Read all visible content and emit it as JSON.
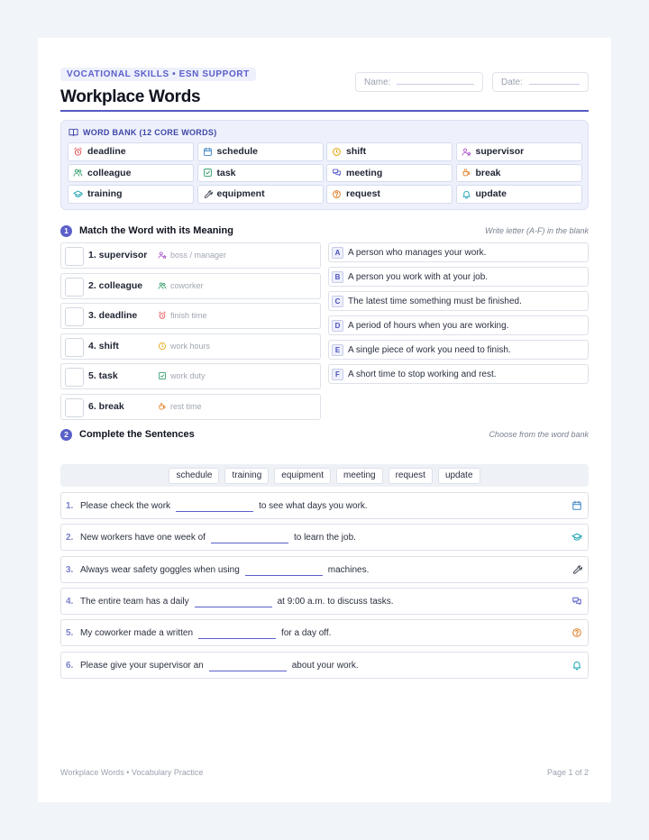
{
  "header": {
    "eyebrow": "VOCATIONAL SKILLS • ESN SUPPORT",
    "title": "Workplace Words",
    "name_label": "Name:",
    "date_label": "Date:"
  },
  "word_bank": {
    "title": "WORD BANK (12 CORE WORDS)",
    "words": [
      {
        "label": "deadline",
        "icon": "alarm-clock-icon",
        "color": "#e5484d"
      },
      {
        "label": "schedule",
        "icon": "calendar-icon",
        "color": "#3b82c4"
      },
      {
        "label": "shift",
        "icon": "clock-icon",
        "color": "#e0a100"
      },
      {
        "label": "supervisor",
        "icon": "user-star-icon",
        "color": "#a855c7"
      },
      {
        "label": "colleague",
        "icon": "users-icon",
        "color": "#2f9e6a"
      },
      {
        "label": "task",
        "icon": "check-square-icon",
        "color": "#2f9e6a"
      },
      {
        "label": "meeting",
        "icon": "chat-bubbles-icon",
        "color": "#5a5fc9"
      },
      {
        "label": "break",
        "icon": "coffee-cup-icon",
        "color": "#e07a1f"
      },
      {
        "label": "training",
        "icon": "graduation-cap-icon",
        "color": "#1aa3b3"
      },
      {
        "label": "equipment",
        "icon": "wrench-icon",
        "color": "#444a57"
      },
      {
        "label": "request",
        "icon": "question-circle-icon",
        "color": "#e07a1f"
      },
      {
        "label": "update",
        "icon": "bell-icon",
        "color": "#1aa3b3"
      }
    ]
  },
  "section1": {
    "number": "1",
    "title": "Match the Word with its Meaning",
    "hint": "Write letter (A-F) in the blank",
    "words": [
      {
        "label": "1. supervisor",
        "hint": "boss / manager",
        "icon": "user-star-icon",
        "color": "#a855c7"
      },
      {
        "label": "2. colleague",
        "hint": "coworker",
        "icon": "users-icon",
        "color": "#2f9e6a"
      },
      {
        "label": "3. deadline",
        "hint": "finish time",
        "icon": "alarm-clock-icon",
        "color": "#e5484d"
      },
      {
        "label": "4. shift",
        "hint": "work hours",
        "icon": "clock-icon",
        "color": "#e0a100"
      },
      {
        "label": "5. task",
        "hint": "work duty",
        "icon": "check-square-icon",
        "color": "#2f9e6a"
      },
      {
        "label": "6. break",
        "hint": "rest time",
        "icon": "coffee-cup-icon",
        "color": "#e07a1f"
      }
    ],
    "definitions": [
      {
        "letter": "A",
        "text": "A person who manages your work."
      },
      {
        "letter": "B",
        "text": "A person you work with at your job."
      },
      {
        "letter": "C",
        "text": "The latest time something must be finished."
      },
      {
        "letter": "D",
        "text": "A period of hours when you are working."
      },
      {
        "letter": "E",
        "text": "A single piece of work you need to finish."
      },
      {
        "letter": "F",
        "text": "A short time to stop working and rest."
      }
    ]
  },
  "section2": {
    "number": "2",
    "title": "Complete the Sentences",
    "hint": "Choose from the word bank",
    "options": [
      "schedule",
      "training",
      "equipment",
      "meeting",
      "request",
      "update"
    ],
    "sentences": [
      {
        "num": "1.",
        "before": "Please check the work",
        "after": "to see what days you work.",
        "icon": "calendar-icon",
        "color": "#3b82c4"
      },
      {
        "num": "2.",
        "before": "New workers have one week of",
        "after": "to learn the job.",
        "icon": "graduation-cap-icon",
        "color": "#1aa3b3"
      },
      {
        "num": "3.",
        "before": "Always wear safety goggles when using",
        "after": "machines.",
        "icon": "wrench-icon",
        "color": "#444a57"
      },
      {
        "num": "4.",
        "before": "The entire team has a daily",
        "after": "at 9:00 a.m. to discuss tasks.",
        "icon": "chat-bubbles-icon",
        "color": "#5a5fc9"
      },
      {
        "num": "5.",
        "before": "My coworker made a written",
        "after": "for a day off.",
        "icon": "question-circle-icon",
        "color": "#e07a1f"
      },
      {
        "num": "6.",
        "before": "Please give your supervisor an",
        "after": "about your work.",
        "icon": "bell-icon",
        "color": "#1aa3b3"
      }
    ]
  },
  "footer": {
    "left": "Workplace Words • Vocabulary Practice",
    "right": "Page 1 of 2"
  }
}
